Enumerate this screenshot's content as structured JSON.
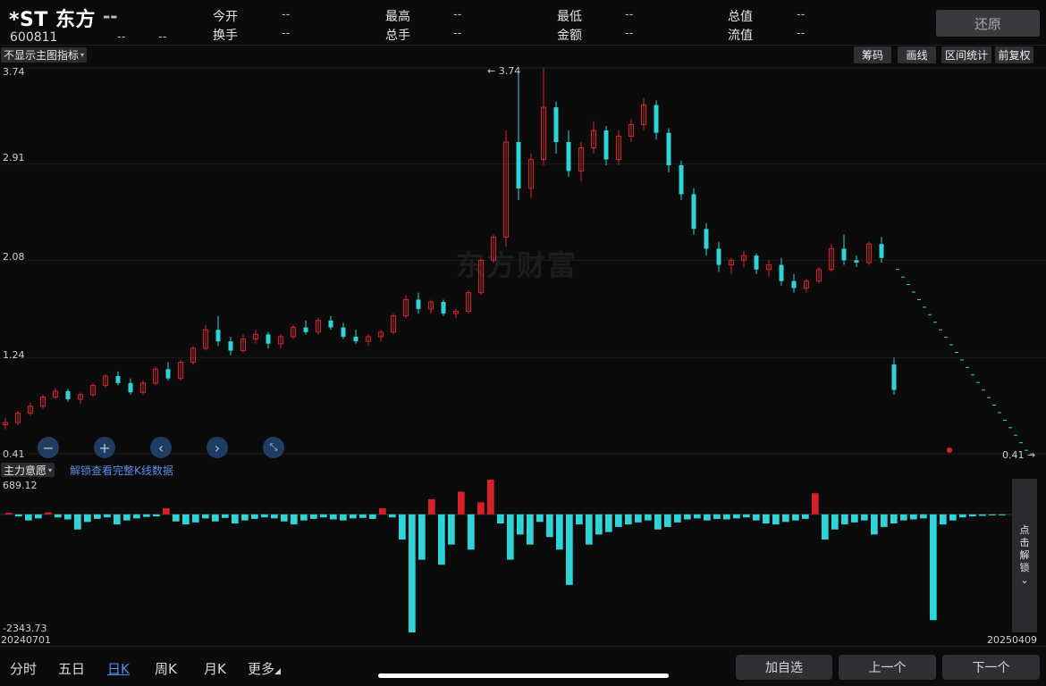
{
  "header": {
    "name": "*ST 东方",
    "price": "--",
    "code": "600811",
    "change": "--",
    "change_pct": "--",
    "stats": [
      {
        "label": "今开",
        "value": "--"
      },
      {
        "label": "最高",
        "value": "--"
      },
      {
        "label": "最低",
        "value": "--"
      },
      {
        "label": "总值",
        "value": "--"
      },
      {
        "label": "换手",
        "value": "--"
      },
      {
        "label": "总手",
        "value": "--"
      },
      {
        "label": "金额",
        "value": "--"
      },
      {
        "label": "流值",
        "value": "--"
      }
    ],
    "restore_label": "还原"
  },
  "toolbar": {
    "indicator_select": "不显示主图指标",
    "buttons": [
      "筹码",
      "画线",
      "区间统计",
      "前复权"
    ]
  },
  "main_chart": {
    "watermark": "东方财富",
    "y_ticks": [
      "3.74",
      "2.91",
      "2.08",
      "1.24",
      "0.41"
    ],
    "max_label": "3.74",
    "min_label": "0.41"
  },
  "sub_chart": {
    "indicator_select": "主力意愿",
    "unlock_link": "解锁查看完整K线数据",
    "max_label": "689.12",
    "min_label": "-2343.73",
    "unlock_side": [
      "点",
      "击",
      "解",
      "锁"
    ],
    "start_date": "20240701",
    "end_date": "20250409"
  },
  "bottom": {
    "tabs": [
      "分时",
      "五日",
      "日K",
      "周K",
      "月K",
      "更多"
    ],
    "buttons": [
      "加自选",
      "上一个",
      "下一个"
    ]
  },
  "colors": {
    "up": "#d8202b",
    "down": "#2fd4d8",
    "accent": "#4c8ef0"
  },
  "icons": [
    "zoom-out-icon",
    "zoom-in-icon",
    "chevron-left-icon",
    "chevron-right-icon",
    "collapse-icon"
  ],
  "chart_data": [
    {
      "type": "candlestick",
      "title": "",
      "ylim": [
        0.41,
        3.74
      ],
      "grid": true,
      "series": [
        {
          "values_ohlc": [
            [
              0.66,
              0.72,
              0.62,
              0.68
            ],
            [
              0.68,
              0.78,
              0.66,
              0.76
            ],
            [
              0.76,
              0.85,
              0.74,
              0.82
            ],
            [
              0.82,
              0.92,
              0.8,
              0.9
            ],
            [
              0.9,
              0.98,
              0.88,
              0.95
            ],
            [
              0.95,
              0.97,
              0.86,
              0.88
            ],
            [
              0.88,
              0.94,
              0.84,
              0.92
            ],
            [
              0.92,
              1.02,
              0.9,
              1.0
            ],
            [
              1.0,
              1.1,
              0.98,
              1.08
            ],
            [
              1.08,
              1.12,
              1.0,
              1.02
            ],
            [
              1.02,
              1.06,
              0.92,
              0.94
            ],
            [
              0.94,
              1.04,
              0.92,
              1.02
            ],
            [
              1.02,
              1.16,
              1.0,
              1.14
            ],
            [
              1.14,
              1.2,
              1.04,
              1.06
            ],
            [
              1.06,
              1.22,
              1.04,
              1.2
            ],
            [
              1.2,
              1.34,
              1.18,
              1.32
            ],
            [
              1.32,
              1.52,
              1.3,
              1.48
            ],
            [
              1.48,
              1.6,
              1.34,
              1.38
            ],
            [
              1.38,
              1.42,
              1.26,
              1.3
            ],
            [
              1.3,
              1.44,
              1.28,
              1.4
            ],
            [
              1.4,
              1.48,
              1.36,
              1.44
            ],
            [
              1.44,
              1.46,
              1.32,
              1.36
            ],
            [
              1.36,
              1.44,
              1.32,
              1.42
            ],
            [
              1.42,
              1.52,
              1.4,
              1.5
            ],
            [
              1.5,
              1.56,
              1.44,
              1.46
            ],
            [
              1.46,
              1.58,
              1.44,
              1.56
            ],
            [
              1.56,
              1.6,
              1.48,
              1.5
            ],
            [
              1.5,
              1.54,
              1.4,
              1.42
            ],
            [
              1.42,
              1.48,
              1.36,
              1.38
            ],
            [
              1.38,
              1.44,
              1.34,
              1.42
            ],
            [
              1.42,
              1.48,
              1.38,
              1.46
            ],
            [
              1.46,
              1.62,
              1.44,
              1.6
            ],
            [
              1.6,
              1.78,
              1.58,
              1.74
            ],
            [
              1.74,
              1.8,
              1.62,
              1.66
            ],
            [
              1.66,
              1.74,
              1.62,
              1.72
            ],
            [
              1.72,
              1.74,
              1.6,
              1.62
            ],
            [
              1.62,
              1.66,
              1.58,
              1.64
            ],
            [
              1.64,
              1.82,
              1.62,
              1.8
            ],
            [
              1.8,
              2.1,
              1.78,
              2.08
            ],
            [
              2.08,
              2.3,
              2.06,
              2.28
            ],
            [
              2.28,
              3.2,
              2.2,
              3.1
            ],
            [
              3.1,
              3.74,
              2.6,
              2.7
            ],
            [
              2.7,
              3.0,
              2.62,
              2.95
            ],
            [
              2.95,
              3.74,
              2.9,
              3.4
            ],
            [
              3.4,
              3.45,
              3.0,
              3.1
            ],
            [
              3.1,
              3.2,
              2.8,
              2.85
            ],
            [
              2.85,
              3.1,
              2.76,
              3.05
            ],
            [
              3.05,
              3.28,
              3.0,
              3.2
            ],
            [
              3.2,
              3.24,
              2.9,
              2.95
            ],
            [
              2.95,
              3.2,
              2.9,
              3.15
            ],
            [
              3.15,
              3.3,
              3.1,
              3.25
            ],
            [
              3.25,
              3.48,
              3.2,
              3.42
            ],
            [
              3.42,
              3.46,
              3.12,
              3.18
            ],
            [
              3.18,
              3.22,
              2.84,
              2.9
            ],
            [
              2.9,
              2.94,
              2.6,
              2.65
            ],
            [
              2.65,
              2.7,
              2.3,
              2.35
            ],
            [
              2.35,
              2.4,
              2.12,
              2.18
            ],
            [
              2.18,
              2.24,
              1.98,
              2.04
            ],
            [
              2.04,
              2.1,
              1.96,
              2.08
            ],
            [
              2.08,
              2.16,
              2.02,
              2.12
            ],
            [
              2.12,
              2.14,
              1.96,
              2.0
            ],
            [
              2.0,
              2.08,
              1.94,
              2.04
            ],
            [
              2.04,
              2.1,
              1.86,
              1.9
            ],
            [
              1.9,
              1.96,
              1.8,
              1.84
            ],
            [
              1.84,
              1.92,
              1.8,
              1.9
            ],
            [
              1.9,
              2.02,
              1.88,
              2.0
            ],
            [
              2.0,
              2.22,
              1.98,
              2.18
            ],
            [
              2.18,
              2.3,
              2.04,
              2.08
            ],
            [
              2.08,
              2.12,
              2.02,
              2.06
            ],
            [
              2.06,
              2.24,
              2.04,
              2.22
            ],
            [
              2.22,
              2.28,
              2.06,
              2.1
            ],
            [
              1.18,
              1.24,
              0.92,
              0.96
            ]
          ]
        }
      ]
    },
    {
      "type": "bar",
      "title": "",
      "ylim": [
        -2343.73,
        689.12
      ],
      "series": [
        {
          "values": [
            30,
            -40,
            -120,
            -80,
            40,
            -60,
            -100,
            -300,
            -150,
            -90,
            -60,
            -200,
            -120,
            -80,
            -50,
            -40,
            120,
            -140,
            -200,
            -160,
            -80,
            -140,
            -70,
            -180,
            -120,
            -90,
            -60,
            -80,
            -140,
            -200,
            -120,
            -90,
            -60,
            -100,
            -120,
            -80,
            -70,
            -90,
            120,
            -60,
            -500,
            -2343.73,
            -900,
            300,
            -1000,
            -600,
            450,
            -700,
            240,
            689.12,
            -180,
            -900,
            -400,
            -600,
            -150,
            -450,
            -700,
            -1400,
            -200,
            -600,
            -400,
            -350,
            -250,
            -200,
            -160,
            -120,
            -300,
            -250,
            -160,
            -100,
            -80,
            -120,
            -90,
            -100,
            -80,
            -60,
            -120,
            -180,
            -200,
            -150,
            -120,
            -90,
            420,
            -500,
            -300,
            -200,
            -160,
            -120,
            -400,
            -250,
            -180,
            -120,
            -100,
            -80,
            -2100,
            -200,
            -120,
            -60,
            -40,
            -30,
            -20,
            -10
          ]
        }
      ]
    }
  ]
}
